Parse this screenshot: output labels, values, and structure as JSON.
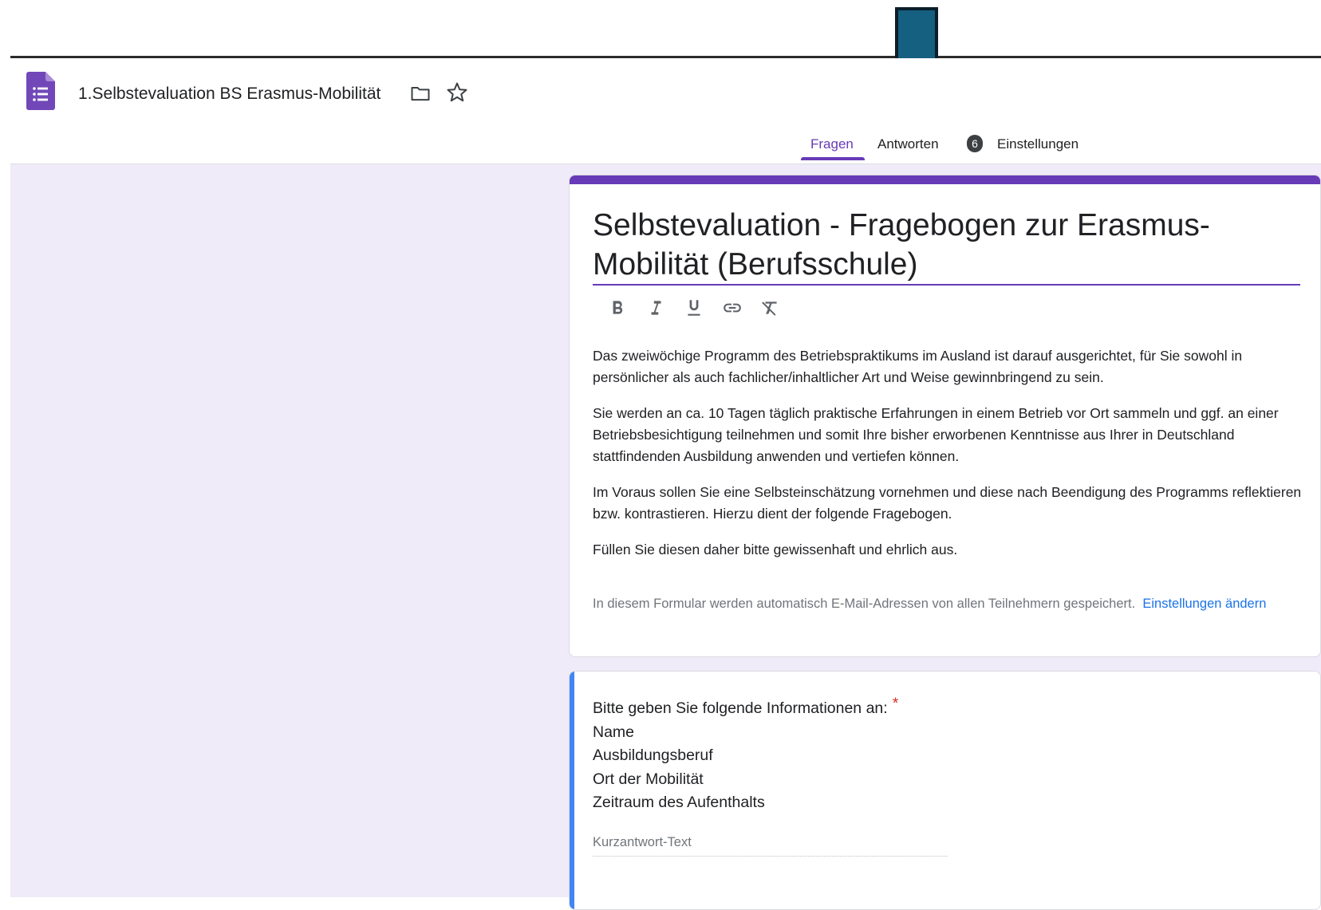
{
  "header": {
    "doc_title": "1.Selbstevaluation BS Erasmus-Mobilität",
    "logo_icon": "google-forms-icon",
    "folder_icon": "folder-icon",
    "star_icon": "star-outline-icon"
  },
  "tabs": [
    {
      "label": "Fragen",
      "active": true
    },
    {
      "label": "Antworten",
      "active": false,
      "badge": "6"
    },
    {
      "label": "Einstellungen",
      "active": false
    }
  ],
  "form": {
    "title": "Selbstevaluation - Fragebogen zur Erasmus-Mobilität (Berufsschule)",
    "toolbar": [
      "bold-icon",
      "italic-icon",
      "underline-icon",
      "link-icon",
      "clear-format-icon"
    ],
    "description": [
      "Das zweiwöchige Programm des Betriebspraktikums im Ausland ist darauf ausgerichtet, für Sie sowohl in persönlicher als auch fachlicher/inhaltlicher Art und Weise gewinnbringend zu sein.",
      "Sie werden an ca. 10 Tagen täglich praktische Erfahrungen in einem Betrieb vor Ort sammeln und ggf. an einer Betriebsbesichtigung teilnehmen und somit Ihre bisher erworbenen Kenntnisse aus Ihrer in Deutschland stattfindenden Ausbildung anwenden und vertiefen können.",
      "Im Voraus sollen Sie eine Selbsteinschätzung vornehmen und diese nach Beendigung des Programms reflektieren bzw. kontrastieren. Hierzu dient der folgende Fragebogen.",
      "Füllen Sie diesen daher bitte gewissenhaft und ehrlich aus."
    ],
    "email_note": "In diesem Formular werden automatisch E-Mail-Adressen von allen Teilnehmern gespeichert.",
    "email_link": "Einstellungen ändern"
  },
  "question": {
    "title": "Bitte geben Sie folgende Informationen an:",
    "required_mark": "*",
    "lines": [
      "Name",
      "Ausbildungsberuf",
      "Ort der Mobilität",
      "Zeitraum des Aufenthalts"
    ],
    "placeholder": "Kurzantwort-Text"
  },
  "colors": {
    "accent": "#673ab7",
    "canvas": "#f0ebf8",
    "question_bar": "#4285f4",
    "arrow": "#155f80"
  }
}
